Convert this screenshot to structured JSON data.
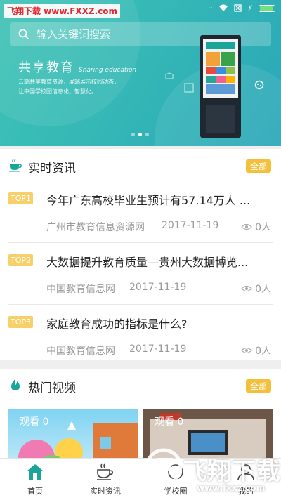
{
  "watermark_top": "飞翔下载 www.FXXZ.com",
  "search": {
    "placeholder": "输入关键词搜索"
  },
  "banner": {
    "title": "共享教育",
    "subtitle": "Sharing education",
    "desc_lines": [
      "云端共享教育资源，屏端展示校园动态，",
      "让中国学校园信息化、智慧化。"
    ],
    "carousel_count": 3,
    "carousel_active": 1
  },
  "news": {
    "title": "实时资讯",
    "all_label": "全部",
    "items": [
      {
        "rank": "TOP1",
        "title": "今年广东高校毕业生预计有57.14万人 ...",
        "source": "广州市教育信息资源网",
        "date": "2017-11-19",
        "views": "0人"
      },
      {
        "rank": "TOP2",
        "title": "大数据提升教育质量—贵州大数据博览...",
        "source": "中国教育信息网",
        "date": "2017-11-19",
        "views": "0人"
      },
      {
        "rank": "TOP3",
        "title": "家庭教育成功的指标是什么?",
        "source": "中国教育信息网",
        "date": "2017-11-19",
        "views": "0人"
      }
    ]
  },
  "video": {
    "title": "热门视频",
    "all_label": "全部",
    "cards": [
      {
        "label": "观看 0"
      },
      {
        "label": "观看 0"
      }
    ]
  },
  "tabs": [
    {
      "label": "首页",
      "icon": "home-icon"
    },
    {
      "label": "实时资讯",
      "icon": "coffee-cup-icon"
    },
    {
      "label": "学校圈",
      "icon": "circle-icon"
    },
    {
      "label": "我的",
      "icon": "user-icon"
    }
  ],
  "watermark_bottom": {
    "name": "飞翔下载",
    "url": "www.fxxz.com"
  },
  "colors": {
    "accent_teal": "#35b8b6",
    "badge_yellow": "#f4c03c",
    "rank_yellow": "#f8d06a",
    "tab_active": "#1aa59a"
  }
}
